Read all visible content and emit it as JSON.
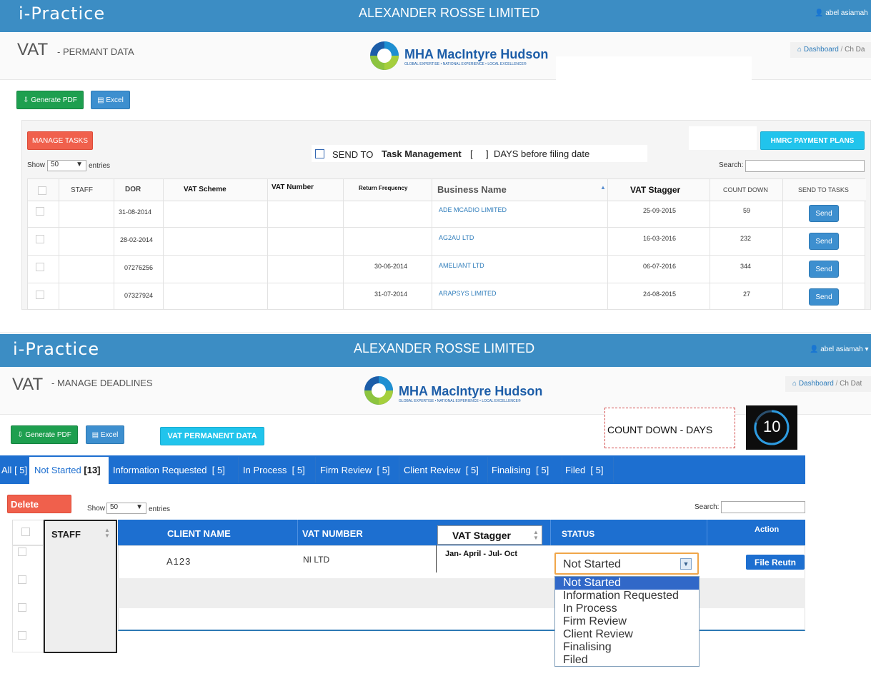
{
  "screen1": {
    "header": {
      "logo": "i-Practice",
      "company": "ALEXANDER ROSSE LIMITED",
      "user": "abel asiamah"
    },
    "page_title": "VAT",
    "page_subtitle": "- PERMANT DATA",
    "brand": {
      "name": "MHA MacIntyre Hudson",
      "tagline": "GLOBAL EXPERTISE • NATIONAL EXPERIENCE • LOCAL EXCELLENCE®"
    },
    "breadcrumb": {
      "home": "Dashboard",
      "current": "Ch Da"
    },
    "buttons": {
      "pdf": "Generate PDF",
      "excel": "Excel",
      "manage_tasks": "MANAGE TASKS",
      "hmrc": "HMRC PAYMENT PLANS"
    },
    "send_to": {
      "prefix": "SEND TO",
      "target": "Task Management",
      "bracket_open": "[",
      "bracket_close": "]",
      "suffix": "DAYS before filing date"
    },
    "show": {
      "label": "Show",
      "value": "50",
      "suffix": "entries"
    },
    "search_label": "Search:",
    "columns": [
      "STAFF",
      "DOR",
      "VAT Scheme",
      "VAT Number",
      "Return Frequency",
      "Business Name",
      "VAT Stagger",
      "COUNT DOWN",
      "SEND TO TASKS"
    ],
    "rows": [
      {
        "dor": "31-08-2014",
        "return_freq": "",
        "business": "ADE MCADIO LIMITED",
        "stagger": "25-09-2015",
        "countdown": "59",
        "send": "Send"
      },
      {
        "dor": "28-02-2014",
        "return_freq": "",
        "business": "AG2AU LTD",
        "stagger": "16-03-2016",
        "countdown": "232",
        "send": "Send"
      },
      {
        "dor": "07276256",
        "return_freq": "30-06-2014",
        "business": "AMELIANT LTD",
        "stagger": "06-07-2016",
        "countdown": "344",
        "send": "Send"
      },
      {
        "dor": "07327924",
        "return_freq": "31-07-2014",
        "business": "ARAPSYS LIMITED",
        "stagger": "24-08-2015",
        "countdown": "27",
        "send": "Send"
      }
    ]
  },
  "screen2": {
    "header": {
      "logo": "i-Practice",
      "company": "ALEXANDER ROSSE LIMITED",
      "user": "abel asiamah"
    },
    "page_title": "VAT",
    "page_subtitle": "- MANAGE DEADLINES",
    "brand": {
      "name": "MHA MacIntyre Hudson",
      "tagline": "GLOBAL EXPERTISE • NATIONAL EXPERIENCE • LOCAL EXCELLENCE®"
    },
    "breadcrumb": {
      "home": "Dashboard",
      "current": "Ch Dat"
    },
    "buttons": {
      "pdf": "Generate PDF",
      "excel": "Excel",
      "vat_perm": "VAT PERMANENT DATA",
      "delete": "Delete"
    },
    "countdown_label": "COUNT DOWN - DAYS",
    "countdown_value": "10",
    "tabs": [
      {
        "label": "All",
        "count": "[ 5]"
      },
      {
        "label": "Not Started",
        "count": "[13]"
      },
      {
        "label": "Information Requested",
        "count": "[ 5]"
      },
      {
        "label": "In Process",
        "count": "[ 5]"
      },
      {
        "label": "Firm Review",
        "count": "[ 5]"
      },
      {
        "label": "Client Review",
        "count": "[ 5]"
      },
      {
        "label": "Finalising",
        "count": "[ 5]"
      },
      {
        "label": "Filed",
        "count": "[ 5]"
      }
    ],
    "show": {
      "label": "Show",
      "value": "50",
      "suffix": "entries"
    },
    "search_label": "Search:",
    "columns": {
      "staff": "STAFF",
      "client": "CLIENT NAME",
      "vat_number": "VAT NUMBER",
      "stagger": "VAT Stagger",
      "status": "STATUS",
      "action": "Action"
    },
    "row": {
      "client": "A123",
      "vat_number": "NI LTD",
      "stagger": "Jan- April - Jul- Oct",
      "status": "Not Started",
      "action": "File Reutn"
    },
    "status_options": [
      "Not Started",
      "Information Requested",
      "In Process",
      "Firm Review",
      "Client Review",
      "Finalising",
      "Filed"
    ]
  }
}
